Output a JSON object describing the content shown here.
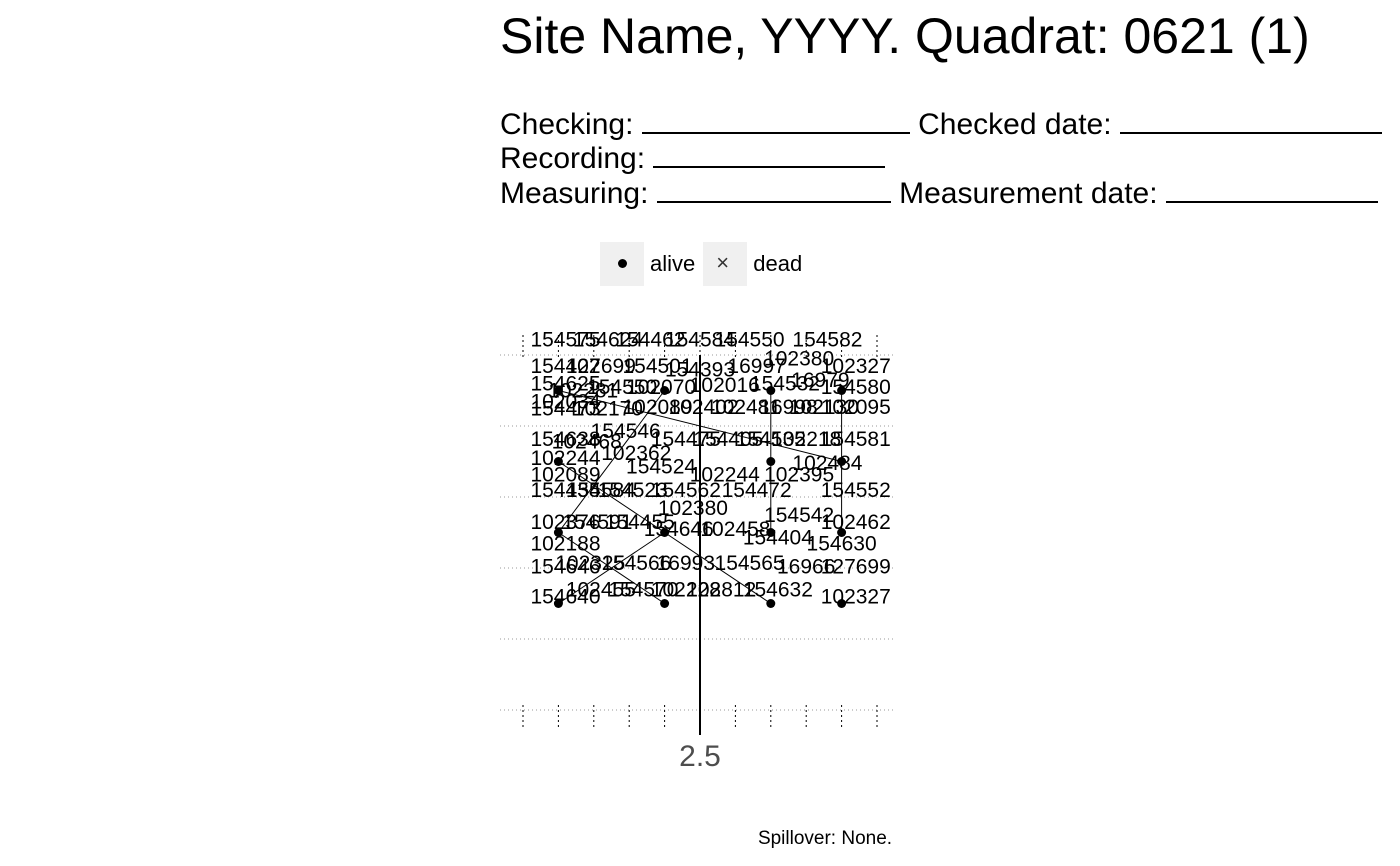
{
  "title": "Site Name, YYYY. Quadrat: 0621 (1)",
  "form": {
    "checking_label": "Checking:",
    "checked_date_label": "Checked date:",
    "recording_label": "Recording:",
    "measuring_label": "Measuring:",
    "measurement_date_label": "Measurement date:"
  },
  "legend": {
    "alive_label": "alive",
    "dead_label": "dead"
  },
  "caption": "Spillover: None.",
  "chart_data": {
    "type": "scatter",
    "x_tick_labels": [
      "2.5"
    ],
    "xlim": [
      0,
      5
    ],
    "ylim": [
      0,
      5
    ],
    "grid": true,
    "legend_placement": "top-left",
    "series": [
      {
        "name": "alive",
        "marker": "filled-circle",
        "points": [
          {
            "x": 0.5,
            "y": 4.5
          },
          {
            "x": 2.0,
            "y": 4.5
          },
          {
            "x": 3.5,
            "y": 4.5
          },
          {
            "x": 4.5,
            "y": 4.5
          },
          {
            "x": 0.5,
            "y": 3.5
          },
          {
            "x": 3.5,
            "y": 3.5
          },
          {
            "x": 4.5,
            "y": 3.5
          },
          {
            "x": 0.5,
            "y": 2.5
          },
          {
            "x": 2.0,
            "y": 2.5
          },
          {
            "x": 3.5,
            "y": 2.5
          },
          {
            "x": 4.5,
            "y": 2.5
          },
          {
            "x": 0.5,
            "y": 1.5
          },
          {
            "x": 2.0,
            "y": 1.5
          },
          {
            "x": 3.5,
            "y": 1.5
          },
          {
            "x": 4.5,
            "y": 1.5
          }
        ]
      }
    ],
    "tag_labels": [
      {
        "text": "154575",
        "x": 0.6,
        "y": 5.12
      },
      {
        "text": "154624",
        "x": 1.2,
        "y": 5.12
      },
      {
        "text": "154462",
        "x": 1.8,
        "y": 5.12
      },
      {
        "text": "154584",
        "x": 2.5,
        "y": 5.12
      },
      {
        "text": "154550",
        "x": 3.2,
        "y": 5.12
      },
      {
        "text": "154582",
        "x": 4.3,
        "y": 5.12
      },
      {
        "text": "102380",
        "x": 3.9,
        "y": 4.85
      },
      {
        "text": "154402",
        "x": 0.6,
        "y": 4.75
      },
      {
        "text": "127699",
        "x": 1.1,
        "y": 4.75
      },
      {
        "text": "154501",
        "x": 1.9,
        "y": 4.75
      },
      {
        "text": "154393",
        "x": 2.5,
        "y": 4.7
      },
      {
        "text": "16997",
        "x": 3.3,
        "y": 4.75
      },
      {
        "text": "102327",
        "x": 4.7,
        "y": 4.75
      },
      {
        "text": "154625",
        "x": 0.6,
        "y": 4.5
      },
      {
        "text": "16979",
        "x": 4.2,
        "y": 4.55
      },
      {
        "text": "102034",
        "x": 0.6,
        "y": 4.25
      },
      {
        "text": "154580",
        "x": 4.7,
        "y": 4.45
      },
      {
        "text": "102281",
        "x": 0.85,
        "y": 4.4
      },
      {
        "text": "154550",
        "x": 1.4,
        "y": 4.45
      },
      {
        "text": "102070",
        "x": 1.95,
        "y": 4.45
      },
      {
        "text": "102016",
        "x": 2.85,
        "y": 4.48
      },
      {
        "text": "154532",
        "x": 3.7,
        "y": 4.5
      },
      {
        "text": "154473",
        "x": 0.6,
        "y": 4.15
      },
      {
        "text": "102170",
        "x": 1.2,
        "y": 4.15
      },
      {
        "text": "102089",
        "x": 1.9,
        "y": 4.17
      },
      {
        "text": "102402",
        "x": 2.55,
        "y": 4.17
      },
      {
        "text": "102481",
        "x": 3.15,
        "y": 4.17
      },
      {
        "text": "16998",
        "x": 3.75,
        "y": 4.17
      },
      {
        "text": "102130",
        "x": 4.25,
        "y": 4.17
      },
      {
        "text": "102095",
        "x": 4.7,
        "y": 4.17
      },
      {
        "text": "154546",
        "x": 1.45,
        "y": 3.83
      },
      {
        "text": "154638",
        "x": 0.6,
        "y": 3.72
      },
      {
        "text": "102468",
        "x": 0.9,
        "y": 3.68
      },
      {
        "text": "154475",
        "x": 2.3,
        "y": 3.72
      },
      {
        "text": "154405",
        "x": 2.9,
        "y": 3.72
      },
      {
        "text": "154535",
        "x": 3.5,
        "y": 3.72
      },
      {
        "text": "102218",
        "x": 4.0,
        "y": 3.72
      },
      {
        "text": "154581",
        "x": 4.7,
        "y": 3.72
      },
      {
        "text": "102362",
        "x": 1.6,
        "y": 3.52
      },
      {
        "text": "102244",
        "x": 0.6,
        "y": 3.45
      },
      {
        "text": "154524",
        "x": 1.95,
        "y": 3.33
      },
      {
        "text": "102484",
        "x": 4.3,
        "y": 3.38
      },
      {
        "text": "102089",
        "x": 0.6,
        "y": 3.22
      },
      {
        "text": "102244",
        "x": 2.85,
        "y": 3.22
      },
      {
        "text": "102395",
        "x": 3.9,
        "y": 3.22
      },
      {
        "text": "154435",
        "x": 0.6,
        "y": 3.0
      },
      {
        "text": "154584",
        "x": 1.1,
        "y": 3.0
      },
      {
        "text": "154523",
        "x": 1.55,
        "y": 3.0
      },
      {
        "text": "154562",
        "x": 2.3,
        "y": 3.0
      },
      {
        "text": "154472",
        "x": 3.3,
        "y": 3.0
      },
      {
        "text": "154552",
        "x": 4.7,
        "y": 3.0
      },
      {
        "text": "102380",
        "x": 2.4,
        "y": 2.75
      },
      {
        "text": "154542",
        "x": 3.9,
        "y": 2.65
      },
      {
        "text": "102376",
        "x": 0.6,
        "y": 2.55
      },
      {
        "text": "154591",
        "x": 1.05,
        "y": 2.55
      },
      {
        "text": "154455",
        "x": 1.65,
        "y": 2.55
      },
      {
        "text": "154646",
        "x": 2.2,
        "y": 2.45
      },
      {
        "text": "102458",
        "x": 3.0,
        "y": 2.45
      },
      {
        "text": "102462",
        "x": 4.7,
        "y": 2.55
      },
      {
        "text": "154404",
        "x": 3.6,
        "y": 2.33
      },
      {
        "text": "102188",
        "x": 0.6,
        "y": 2.25
      },
      {
        "text": "154630",
        "x": 4.5,
        "y": 2.25
      },
      {
        "text": "102325",
        "x": 0.95,
        "y": 1.97
      },
      {
        "text": "154566",
        "x": 1.6,
        "y": 1.97
      },
      {
        "text": "16993",
        "x": 2.3,
        "y": 1.97
      },
      {
        "text": "154565",
        "x": 3.2,
        "y": 1.97
      },
      {
        "text": "16966",
        "x": 4.0,
        "y": 1.92
      },
      {
        "text": "127699",
        "x": 4.7,
        "y": 1.92
      },
      {
        "text": "154646",
        "x": 0.6,
        "y": 1.92
      },
      {
        "text": "102455",
        "x": 1.1,
        "y": 1.6
      },
      {
        "text": "154570",
        "x": 1.7,
        "y": 1.6
      },
      {
        "text": "102228",
        "x": 2.3,
        "y": 1.6
      },
      {
        "text": "102812",
        "x": 2.8,
        "y": 1.6
      },
      {
        "text": "154632",
        "x": 3.6,
        "y": 1.6
      },
      {
        "text": "154640",
        "x": 0.6,
        "y": 1.5
      },
      {
        "text": "102327",
        "x": 4.7,
        "y": 1.5
      }
    ]
  }
}
